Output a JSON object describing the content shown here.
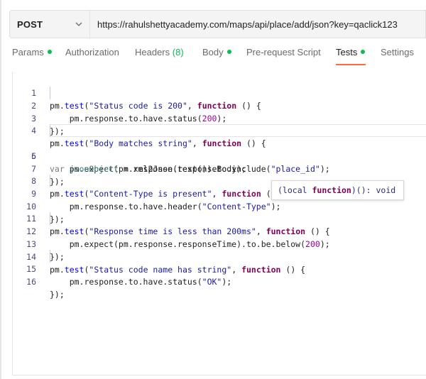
{
  "request": {
    "method": "POST",
    "url": "https://rahulshettyacademy.com/maps/api/place/add/json?key=qaclick123"
  },
  "tabs": [
    {
      "label": "Params",
      "dot": true
    },
    {
      "label": "Authorization"
    },
    {
      "label": "Headers",
      "count": "(8)"
    },
    {
      "label": "Body",
      "dot": true
    },
    {
      "label": "Pre-request Script"
    },
    {
      "label": "Tests",
      "dot": true,
      "active": true
    },
    {
      "label": "Settings"
    }
  ],
  "colors": {
    "accent": "#ff6c37",
    "dot": "#0cbb52"
  },
  "editor": {
    "lines": [
      {
        "n": "1"
      },
      {
        "n": "2"
      },
      {
        "n": "3"
      },
      {
        "n": "4"
      },
      {
        "n": "5"
      },
      {
        "n": "6"
      },
      {
        "n": "7"
      },
      {
        "n": "8"
      },
      {
        "n": "9"
      },
      {
        "n": "10"
      },
      {
        "n": "11"
      },
      {
        "n": "12"
      },
      {
        "n": "13"
      },
      {
        "n": "14"
      },
      {
        "n": "15"
      },
      {
        "n": "16"
      }
    ],
    "tokens": {
      "l1": [
        "pm.",
        "test",
        "(",
        "\"Status code is 200\"",
        ", ",
        "function",
        " () {"
      ],
      "l2": [
        "    pm.response.to.have.status(",
        "200",
        ");"
      ],
      "l3": [
        "});"
      ],
      "l4": [
        "pm.",
        "test",
        "(",
        "\"Body matches string\"",
        ", ",
        "function",
        " () {"
      ],
      "l5": [
        "    pm.expect(pm.response.text()).to.include(",
        "\"place_id\"",
        ");"
      ],
      "l6": [
        "var ",
        "jsonObject",
        " = xml2Json(responseBody);"
      ],
      "l7": [
        "});"
      ],
      "l8": [
        "pm.",
        "test",
        "(",
        "\"Content-Type is present\"",
        ", ",
        "function",
        " () {"
      ],
      "l9": [
        "    pm.response.to.have.header(",
        "\"Content-Type\"",
        ");"
      ],
      "l10": [
        "});"
      ],
      "l11": [
        "pm.",
        "test",
        "(",
        "\"Response time is less than 200ms\"",
        ", ",
        "function",
        " () {"
      ],
      "l12": [
        "    pm.expect(pm.response.responseTime).to.be.below(",
        "200",
        ");"
      ],
      "l13": [
        "});"
      ],
      "l14": [
        "pm.",
        "test",
        "(",
        "\"Status code name has string\"",
        ", ",
        "function",
        " () {"
      ],
      "l15": [
        "    pm.response.to.have.status(",
        "\"OK\"",
        ");"
      ],
      "l16": [
        "});"
      ]
    }
  },
  "tooltip": {
    "open": "(local ",
    "keyword": "function",
    "rest": ")(): void"
  }
}
